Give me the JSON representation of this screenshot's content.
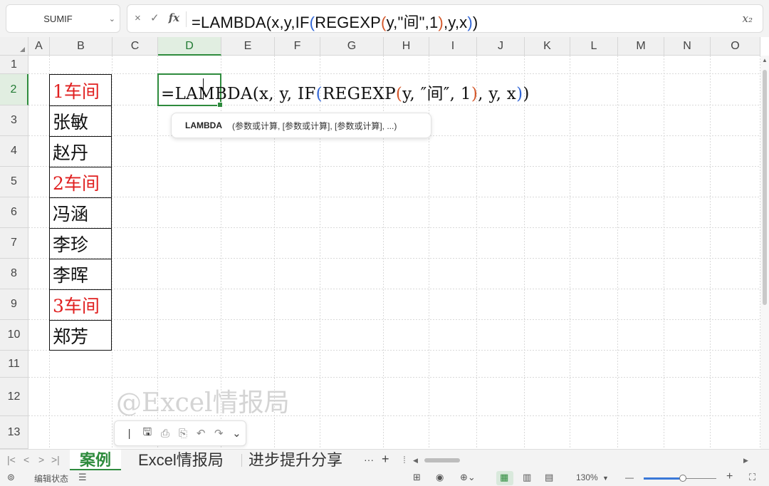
{
  "formula_bar": {
    "name_box": "SUMIF",
    "cancel_icon": "×",
    "enter_icon": "✓",
    "fx_label": "fx",
    "formula_parts": [
      "=LAMBDA(x,y,IF",
      "(",
      "REGEXP",
      "(",
      "y,\"间\",1",
      ")",
      ",y,x",
      ")",
      ")"
    ],
    "expand_icon": "x₂"
  },
  "columns": [
    "A",
    "B",
    "C",
    "D",
    "E",
    "F",
    "G",
    "H",
    "I",
    "J",
    "K",
    "L",
    "M",
    "N",
    "O"
  ],
  "rows": [
    "1",
    "2",
    "3",
    "4",
    "5",
    "6",
    "7",
    "8",
    "9",
    "10",
    "11",
    "12",
    "13"
  ],
  "selected_column": "D",
  "selected_row": "2",
  "column_b_values": [
    {
      "row": "2",
      "text": "1车间",
      "highlight": true
    },
    {
      "row": "3",
      "text": "张敏",
      "highlight": false
    },
    {
      "row": "4",
      "text": "赵丹",
      "highlight": false
    },
    {
      "row": "5",
      "text": "2车间",
      "highlight": true
    },
    {
      "row": "6",
      "text": "冯涵",
      "highlight": false
    },
    {
      "row": "7",
      "text": "李珍",
      "highlight": false
    },
    {
      "row": "8",
      "text": "李晖",
      "highlight": false
    },
    {
      "row": "9",
      "text": "3车间",
      "highlight": true
    },
    {
      "row": "10",
      "text": "郑芳",
      "highlight": false
    }
  ],
  "cell_d2_edit_parts": [
    "=LAMBDA(x, y, IF",
    "(",
    "REGEXP",
    "(",
    "y, ″间″, 1",
    ")",
    ", y, x",
    ")",
    ")"
  ],
  "tooltip": {
    "function": "LAMBDA",
    "args": "(参数或计算, [参数或计算], [参数或计算], ...)"
  },
  "watermark": "@Excel情报局",
  "quick_toolbar": {
    "icons": [
      "save-icon",
      "print-icon",
      "print-preview-icon",
      "undo-icon",
      "redo-icon",
      "chevron-down-icon"
    ]
  },
  "sheet_tabs": [
    "案例",
    "Excel情报局",
    "进步提升分享"
  ],
  "active_sheet": "案例",
  "tab_more": "···",
  "tab_add": "+",
  "status_bar": {
    "mode": "编辑状态",
    "zoom": "130%",
    "zoom_minus": "—",
    "zoom_plus": "+"
  },
  "colors": {
    "accent_green": "#2e8b3d",
    "highlight_red": "#e02020",
    "paren_level1": "#3367d6",
    "paren_level2": "#d4582b"
  }
}
